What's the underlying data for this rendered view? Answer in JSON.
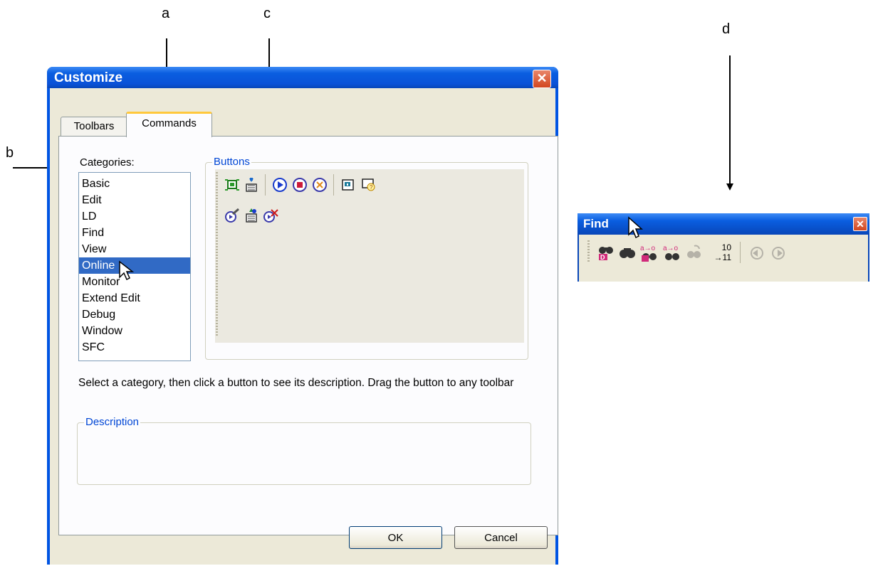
{
  "callouts": {
    "a": "a",
    "b": "b",
    "c": "c",
    "d": "d"
  },
  "dialog": {
    "title": "Customize",
    "close_glyph": "✕",
    "tabs": [
      {
        "label": "Toolbars"
      },
      {
        "label": "Commands"
      }
    ],
    "categories_label": "Categories:",
    "categories": [
      "Basic",
      "Edit",
      "LD",
      "Find",
      "View",
      "Online",
      "Monitor",
      "Extend Edit",
      "Debug",
      "Window",
      "SFC"
    ],
    "selected_category": "Online",
    "buttons_group_label": "Buttons",
    "buttons_row1_icons": [
      "connect-icon",
      "download-icon",
      "run-icon",
      "stop-icon",
      "pause-icon",
      "plc-info-icon",
      "plc-error-icon"
    ],
    "buttons_row2_icons": [
      "write-icon",
      "upload-icon",
      "clear-icon"
    ],
    "help_text": "Select a category, then click a button to see its description. Drag the button to any toolbar",
    "description_group_label": "Description",
    "description_text": "",
    "ok_label": "OK",
    "cancel_label": "Cancel"
  },
  "find_toolbar": {
    "title": "Find",
    "close_glyph": "✕",
    "icons": [
      "find-device-icon",
      "find-icon",
      "replace-device-icon",
      "replace-icon",
      "find-replace-icon",
      "renumber-icon",
      "previous-icon",
      "next-icon"
    ],
    "renumber_top": "10",
    "renumber_bottom": "→11"
  },
  "colors": {
    "titlebar": "#0a5ee0",
    "selection": "#316ac5",
    "group_label": "#0046d5",
    "dialog_face": "#ece9d8"
  }
}
